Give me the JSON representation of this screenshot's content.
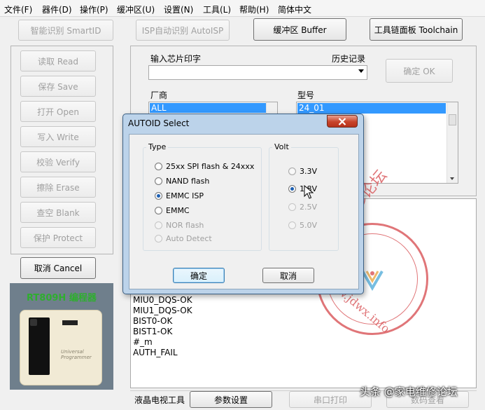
{
  "menu": [
    "文件(F)",
    "器件(D)",
    "操作(P)",
    "缓冲区(U)",
    "设置(N)",
    "工具(L)",
    "帮助(H)",
    "简体中文"
  ],
  "toolbar": {
    "smart_id": "智能识别 SmartID",
    "isp_auto": "ISP自动识别 AutoISP",
    "buffer": "缓冲区 Buffer",
    "toolchain": "工具链面板 Toolchain"
  },
  "actions": [
    "读取 Read",
    "保存 Save",
    "打开 Open",
    "写入 Write",
    "校验 Verify",
    "擦除 Erase",
    "查空 Blank",
    "保护 Protect"
  ],
  "cancel": "取消 Cancel",
  "product": {
    "name": "RT809H 编程器",
    "device_label": "Universal Programmer"
  },
  "chip": {
    "input_label": "输入芯片印字",
    "history_label": "历史记录",
    "input_value": "",
    "confirm": "确定 OK",
    "vendor_label": "厂商",
    "model_label": "型号",
    "vendor_selected": "ALL",
    "model_selected": "24_01"
  },
  "log_lines": [
    "MIU0_DQS-OK",
    "MIU1_DQS-OK",
    "BIST0-OK",
    "BIST1-OK",
    "#_m",
    "AUTH_FAIL"
  ],
  "bottom": {
    "lcd_tools": "液晶电视工具",
    "params": "参数设置",
    "serial_print": "串口打印",
    "view": "数码查看"
  },
  "dialog": {
    "title": "AUTOID Select",
    "type_title": "Type",
    "volt_title": "Volt",
    "types": [
      {
        "label": "25xx SPI flash & 24xxx",
        "checked": false,
        "enabled": true
      },
      {
        "label": "NAND flash",
        "checked": false,
        "enabled": true
      },
      {
        "label": "EMMC ISP",
        "checked": true,
        "enabled": true
      },
      {
        "label": "EMMC",
        "checked": false,
        "enabled": true
      },
      {
        "label": "NOR flash",
        "checked": false,
        "enabled": false
      },
      {
        "label": "Auto Detect",
        "checked": false,
        "enabled": false
      }
    ],
    "volts": [
      {
        "label": "3.3V",
        "checked": false,
        "enabled": true
      },
      {
        "label": "1.8V",
        "checked": true,
        "enabled": true
      },
      {
        "label": "2.5V",
        "checked": false,
        "enabled": false
      },
      {
        "label": "5.0V",
        "checked": false,
        "enabled": false
      }
    ],
    "ok": "确定",
    "cancel": "取消"
  },
  "watermark": {
    "forum": "家电维修论坛",
    "url": "www.jdwx.info",
    "caption": "头条 @家电维修论坛"
  },
  "colors": {
    "selection": "#3399ff",
    "watermark": "#d6484c",
    "product_text": "#2fae2f"
  }
}
